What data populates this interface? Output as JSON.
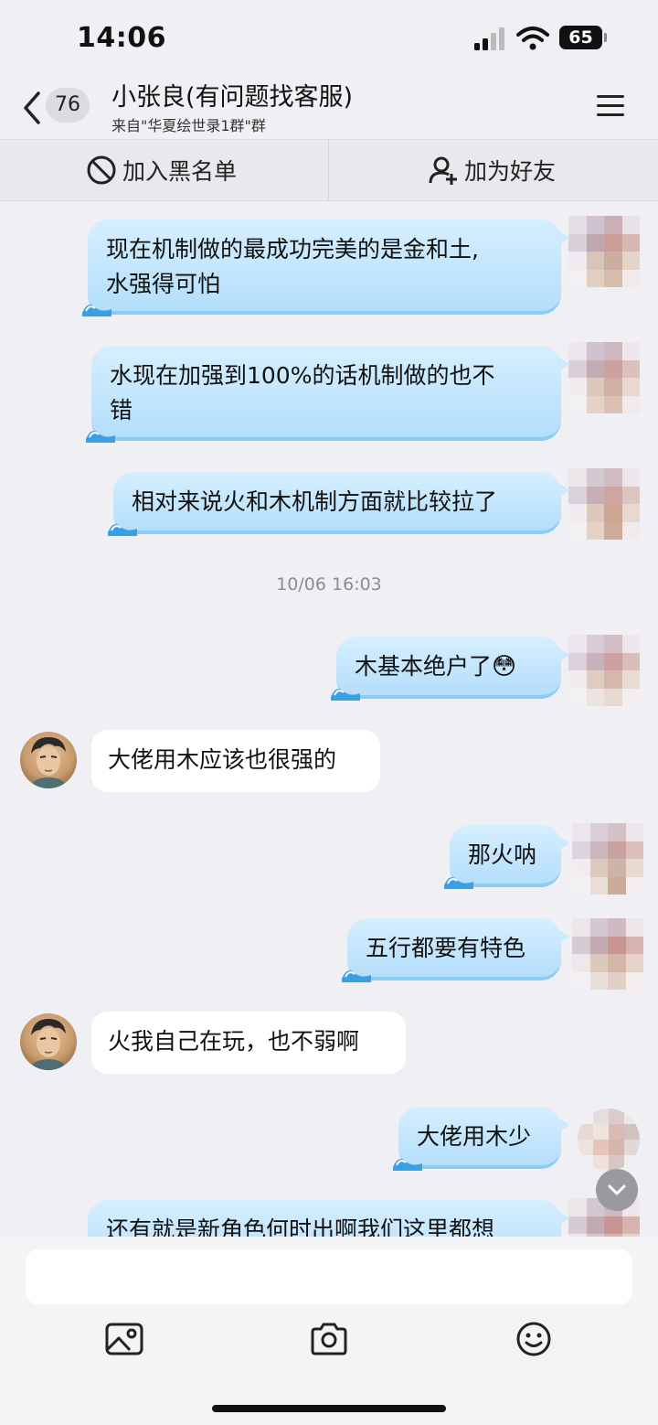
{
  "status_bar": {
    "time": "14:06",
    "battery": "65"
  },
  "header": {
    "unread_count": "76",
    "title": "小张良(有问题找客服)",
    "subtitle": "来自\"华夏绘世录1群\"群"
  },
  "actions": {
    "blacklist_label": "加入黑名单",
    "add_friend_label": "加为好友"
  },
  "timestamp": "10/06 16:03",
  "messages": [
    {
      "side": "right",
      "line1": "现在机制做的最成功完美的是金和土,",
      "line2": "水强得可怕"
    },
    {
      "side": "right",
      "line1": "水现在加强到100%的话机制做的也不",
      "line2": "错"
    },
    {
      "side": "right",
      "text": "相对来说火和木机制方面就比较拉了"
    },
    {
      "side": "right",
      "text": "木基本绝户了",
      "emoji": "😳"
    },
    {
      "side": "left",
      "text": "大佬用木应该也很强的"
    },
    {
      "side": "right",
      "text": "那火呐"
    },
    {
      "side": "right",
      "text": "五行都要有特色"
    },
    {
      "side": "left",
      "text": "火我自己在玩，也不弱啊"
    },
    {
      "side": "right",
      "text": "大佬用木少"
    },
    {
      "side": "right",
      "text": "还有就是新角色何时出啊我们这里都想"
    }
  ],
  "input": {
    "placeholder": ""
  },
  "icons": {
    "back": "chevron-left-icon",
    "menu": "hamburger-icon",
    "block": "block-icon",
    "add_friend": "add-user-icon",
    "image": "image-icon",
    "camera": "camera-icon",
    "emoji": "smile-icon",
    "scroll": "chevron-down-icon"
  },
  "colors": {
    "bubble_right": "#c4e6fd",
    "bubble_left": "#ffffff",
    "background": "#f0f0f4"
  }
}
